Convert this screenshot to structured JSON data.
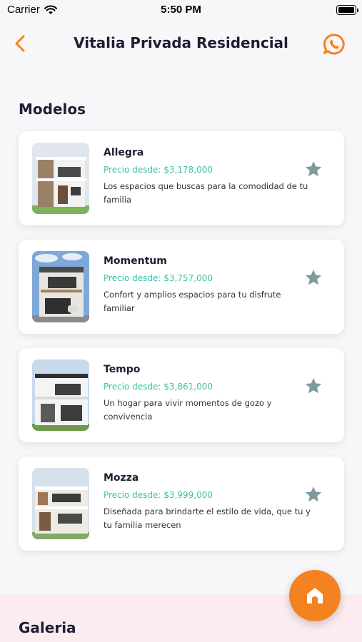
{
  "status_bar": {
    "carrier": "Carrier",
    "time": "5:50 PM"
  },
  "header": {
    "title": "Vitalia Privada Residencial",
    "back_icon": "chevron-left-icon",
    "whatsapp_icon": "whatsapp-icon"
  },
  "colors": {
    "accent": "#f58220",
    "price": "#3cc2a8",
    "star": "#7f9a9c",
    "gallery_bg": "#fcecef"
  },
  "models_section": {
    "title": "Modelos",
    "items": [
      {
        "name": "Allegra",
        "price": "Precio desde: $3,178,000",
        "description": " Los espacios que buscas para la comodidad de tu familia"
      },
      {
        "name": "Momentum",
        "price": "Precio desde: $3,757,000",
        "description": "Confort y amplios espacios para tu disfrute familiar"
      },
      {
        "name": "Tempo",
        "price": "Precio desde: $3,861,000",
        "description": "Un hogar para vivir momentos de gozo y convivencia"
      },
      {
        "name": "Mozza",
        "price": "Precio desde: $3,999,000",
        "description": "Diseñada para brindarte el estilo de vida, que tu y tu familia merecen"
      }
    ]
  },
  "gallery_section": {
    "title": "Galeria"
  },
  "fab": {
    "icon": "home-icon"
  }
}
